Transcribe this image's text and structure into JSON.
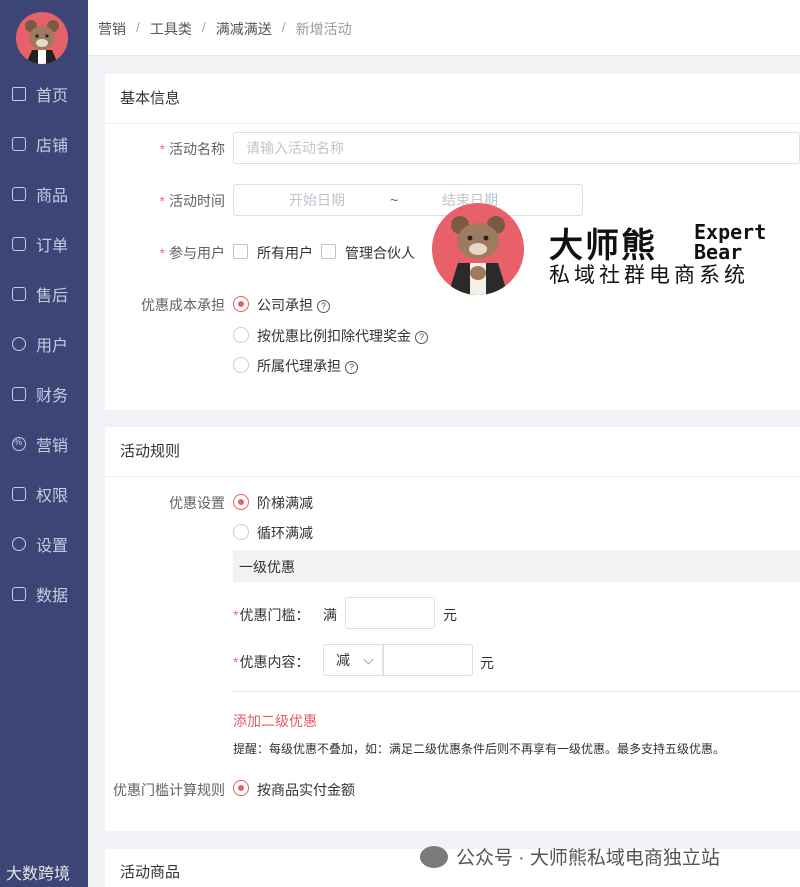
{
  "sidebar": {
    "items": [
      {
        "label": "首页",
        "icon": "home-icon"
      },
      {
        "label": "店铺",
        "icon": "store-icon"
      },
      {
        "label": "商品",
        "icon": "bag-icon"
      },
      {
        "label": "订单",
        "icon": "order-icon"
      },
      {
        "label": "售后",
        "icon": "after-sale-icon"
      },
      {
        "label": "用户",
        "icon": "user-icon"
      },
      {
        "label": "财务",
        "icon": "wallet-icon"
      },
      {
        "label": "营销",
        "icon": "percent-icon"
      },
      {
        "label": "权限",
        "icon": "lock-icon"
      },
      {
        "label": "设置",
        "icon": "gear-icon"
      },
      {
        "label": "数据",
        "icon": "chart-icon"
      }
    ]
  },
  "breadcrumb": [
    "营销",
    "工具类",
    "满减满送",
    "新增活动"
  ],
  "basic": {
    "title": "基本信息",
    "name_label": "活动名称",
    "name_placeholder": "请输入活动名称",
    "time_label": "活动时间",
    "start_placeholder": "开始日期",
    "range_sep": "~",
    "end_placeholder": "结束日期",
    "users_label": "参与用户",
    "user_opts": [
      "所有用户",
      "管理合伙人"
    ],
    "cost_label": "优惠成本承担",
    "cost_opts": [
      "公司承担",
      "按优惠比例扣除代理奖金",
      "所属代理承担"
    ]
  },
  "rules": {
    "title": "活动规则",
    "setting_label": "优惠设置",
    "setting_opts": [
      "阶梯满减",
      "循环满减"
    ],
    "level_title": "一级优惠",
    "threshold_label": "优惠门槛：",
    "threshold_prefix": "满",
    "threshold_unit": "元",
    "content_label": "优惠内容：",
    "content_select": "减",
    "content_unit": "元",
    "add_level": "添加二级优惠",
    "tip": "提醒：每级优惠不叠加，如：满足二级优惠条件后则不再享有一级优惠。最多支持五级优惠。",
    "calc_label": "优惠门槛计算规则",
    "calc_opt": "按商品实付金额"
  },
  "goods": {
    "title": "活动商品"
  },
  "overlay": {
    "brand_cn": "大师熊",
    "brand_en1": "Expert",
    "brand_en2": "Bear",
    "brand_sub": "私域社群电商系统",
    "wm_bottom": "公众号 · 大师熊私域电商独立站",
    "wm_left": "大数跨境"
  },
  "colors": {
    "sidebar": "#3d4577",
    "accent": "#e85c63"
  }
}
